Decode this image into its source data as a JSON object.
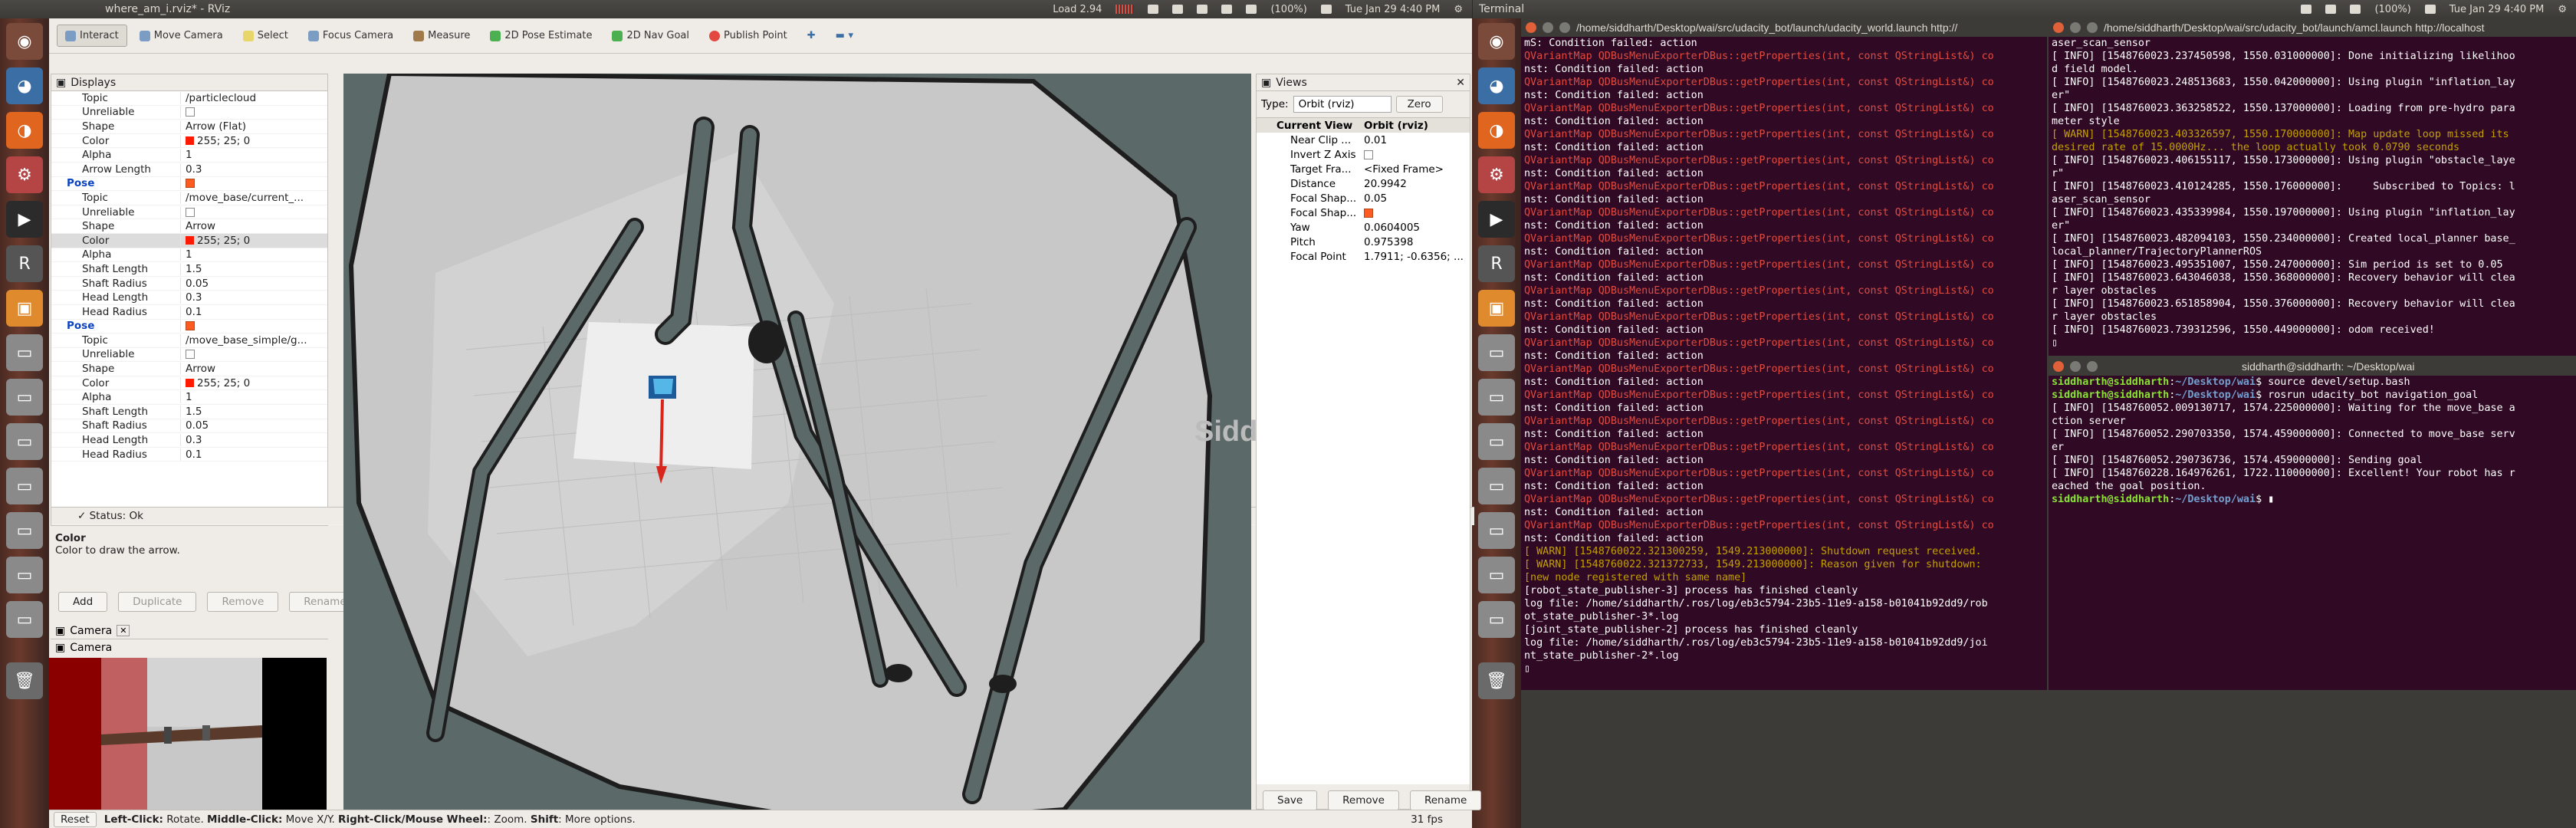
{
  "menubar_left": {
    "title": "where_am_i.rviz* - RViz",
    "load": "Load 2.94",
    "battery": "(100%)",
    "clock": "Tue Jan 29 4:40 PM"
  },
  "menubar_right": {
    "title": "Terminal",
    "battery": "(100%)",
    "clock": "Tue Jan 29 4:40 PM"
  },
  "toolbar": {
    "interact": "Interact",
    "move_camera": "Move Camera",
    "select": "Select",
    "focus_camera": "Focus Camera",
    "measure": "Measure",
    "pose_estimate": "2D Pose Estimate",
    "nav_goal": "2D Nav Goal",
    "publish_point": "Publish Point"
  },
  "displays": {
    "title": "Displays",
    "rows": [
      {
        "k": "Topic",
        "v": "/particlecloud"
      },
      {
        "k": "Unreliable",
        "v": "",
        "chk": "off"
      },
      {
        "k": "Shape",
        "v": "Arrow (Flat)"
      },
      {
        "k": "Color",
        "v": "255; 25; 0",
        "swatch": true
      },
      {
        "k": "Alpha",
        "v": "1"
      },
      {
        "k": "Arrow Length",
        "v": "0.3"
      },
      {
        "k": "Pose",
        "v": "",
        "chk": "on",
        "sec": true
      },
      {
        "k": "✓ Status: Ok",
        "v": "",
        "status": true
      },
      {
        "k": "Topic",
        "v": "/move_base/current_..."
      },
      {
        "k": "Unreliable",
        "v": "",
        "chk": "off"
      },
      {
        "k": "Shape",
        "v": "Arrow"
      },
      {
        "k": "Color",
        "v": "255; 25; 0",
        "swatch": true,
        "sel": true
      },
      {
        "k": "Alpha",
        "v": "1"
      },
      {
        "k": "Shaft Length",
        "v": "1.5"
      },
      {
        "k": "Shaft Radius",
        "v": "0.05"
      },
      {
        "k": "Head Length",
        "v": "0.3"
      },
      {
        "k": "Head Radius",
        "v": "0.1"
      },
      {
        "k": "Pose",
        "v": "",
        "chk": "on",
        "sec": true
      },
      {
        "k": "✓ Status: Ok",
        "v": "",
        "status": true
      },
      {
        "k": "Topic",
        "v": "/move_base_simple/g..."
      },
      {
        "k": "Unreliable",
        "v": "",
        "chk": "off"
      },
      {
        "k": "Shape",
        "v": "Arrow"
      },
      {
        "k": "Color",
        "v": "255; 25; 0",
        "swatch": true
      },
      {
        "k": "Alpha",
        "v": "1"
      },
      {
        "k": "Shaft Length",
        "v": "1.5"
      },
      {
        "k": "Shaft Radius",
        "v": "0.05"
      },
      {
        "k": "Head Length",
        "v": "0.3"
      },
      {
        "k": "Head Radius",
        "v": "0.1"
      }
    ]
  },
  "description": {
    "title": "Color",
    "text": "Color to draw the arrow."
  },
  "buttons": {
    "add": "Add",
    "duplicate": "Duplicate",
    "remove": "Remove",
    "rename": "Rename"
  },
  "camera": {
    "tab1": "Camera",
    "tab2": "Camera"
  },
  "status": {
    "reset": "Reset",
    "hint_b1": "Left-Click:",
    "hint_t1": " Rotate. ",
    "hint_b2": "Middle-Click:",
    "hint_t2": " Move X/Y. ",
    "hint_b3": "Right-Click/Mouse Wheel:",
    "hint_t3": ": Zoom. ",
    "hint_b4": "Shift",
    "hint_t4": ": More options.",
    "fps": "31 fps"
  },
  "views": {
    "title": "Views",
    "type_label": "Type:",
    "type_value": "Orbit (rviz)",
    "zero": "Zero",
    "header_k": "Current View",
    "header_v": "Orbit (rviz)",
    "rows": [
      {
        "k": "Near Clip ...",
        "v": "0.01"
      },
      {
        "k": "Invert Z Axis",
        "v": "",
        "chk": "off"
      },
      {
        "k": "Target Fra...",
        "v": "<Fixed Frame>"
      },
      {
        "k": "Distance",
        "v": "20.9942"
      },
      {
        "k": "Focal Shap...",
        "v": "0.05"
      },
      {
        "k": "Focal Shap...",
        "v": "",
        "chk": "on"
      },
      {
        "k": "Yaw",
        "v": "0.0604005"
      },
      {
        "k": "Pitch",
        "v": "0.975398"
      },
      {
        "k": "Focal Point",
        "v": "1.7911; -0.6356; ..."
      }
    ],
    "save": "Save",
    "remove": "Remove",
    "rename": "Rename"
  },
  "watermark": "Siddharth Kothiyal",
  "term1": {
    "title": "/home/siddharth/Desktop/wai/src/udacity_bot/launch/udacity_world.launch http://",
    "lines": [
      {
        "c": "",
        "t": "mS: Condition failed: action"
      },
      {
        "c": "red",
        "t": "QVariantMap QDBusMenuExporterDBus::getProperties(int, const QStringList&) co"
      },
      {
        "c": "",
        "t": "nst: Condition failed: action"
      },
      {
        "c": "red",
        "t": "QVariantMap QDBusMenuExporterDBus::getProperties(int, const QStringList&) co"
      },
      {
        "c": "",
        "t": "nst: Condition failed: action"
      },
      {
        "c": "red",
        "t": "QVariantMap QDBusMenuExporterDBus::getProperties(int, const QStringList&) co"
      },
      {
        "c": "",
        "t": "nst: Condition failed: action"
      },
      {
        "c": "red",
        "t": "QVariantMap QDBusMenuExporterDBus::getProperties(int, const QStringList&) co"
      },
      {
        "c": "",
        "t": "nst: Condition failed: action"
      },
      {
        "c": "red",
        "t": "QVariantMap QDBusMenuExporterDBus::getProperties(int, const QStringList&) co"
      },
      {
        "c": "",
        "t": "nst: Condition failed: action"
      },
      {
        "c": "red",
        "t": "QVariantMap QDBusMenuExporterDBus::getProperties(int, const QStringList&) co"
      },
      {
        "c": "",
        "t": "nst: Condition failed: action"
      },
      {
        "c": "red",
        "t": "QVariantMap QDBusMenuExporterDBus::getProperties(int, const QStringList&) co"
      },
      {
        "c": "",
        "t": "nst: Condition failed: action"
      },
      {
        "c": "red",
        "t": "QVariantMap QDBusMenuExporterDBus::getProperties(int, const QStringList&) co"
      },
      {
        "c": "",
        "t": "nst: Condition failed: action"
      },
      {
        "c": "red",
        "t": "QVariantMap QDBusMenuExporterDBus::getProperties(int, const QStringList&) co"
      },
      {
        "c": "",
        "t": "nst: Condition failed: action"
      },
      {
        "c": "red",
        "t": "QVariantMap QDBusMenuExporterDBus::getProperties(int, const QStringList&) co"
      },
      {
        "c": "",
        "t": "nst: Condition failed: action"
      },
      {
        "c": "red",
        "t": "QVariantMap QDBusMenuExporterDBus::getProperties(int, const QStringList&) co"
      },
      {
        "c": "",
        "t": "nst: Condition failed: action"
      },
      {
        "c": "red",
        "t": "QVariantMap QDBusMenuExporterDBus::getProperties(int, const QStringList&) co"
      },
      {
        "c": "",
        "t": "nst: Condition failed: action"
      },
      {
        "c": "red",
        "t": "QVariantMap QDBusMenuExporterDBus::getProperties(int, const QStringList&) co"
      },
      {
        "c": "",
        "t": "nst: Condition failed: action"
      },
      {
        "c": "red",
        "t": "QVariantMap QDBusMenuExporterDBus::getProperties(int, const QStringList&) co"
      },
      {
        "c": "",
        "t": "nst: Condition failed: action"
      },
      {
        "c": "red",
        "t": "QVariantMap QDBusMenuExporterDBus::getProperties(int, const QStringList&) co"
      },
      {
        "c": "",
        "t": "nst: Condition failed: action"
      },
      {
        "c": "red",
        "t": "QVariantMap QDBusMenuExporterDBus::getProperties(int, const QStringList&) co"
      },
      {
        "c": "",
        "t": "nst: Condition failed: action"
      },
      {
        "c": "red",
        "t": "QVariantMap QDBusMenuExporterDBus::getProperties(int, const QStringList&) co"
      },
      {
        "c": "",
        "t": "nst: Condition failed: action"
      },
      {
        "c": "red",
        "t": "QVariantMap QDBusMenuExporterDBus::getProperties(int, const QStringList&) co"
      },
      {
        "c": "",
        "t": "nst: Condition failed: action"
      },
      {
        "c": "red",
        "t": "QVariantMap QDBusMenuExporterDBus::getProperties(int, const QStringList&) co"
      },
      {
        "c": "",
        "t": "nst: Condition failed: action"
      },
      {
        "c": "yel",
        "t": "[ WARN] [1548760022.321300259, 1549.213000000]: Shutdown request received."
      },
      {
        "c": "yel",
        "t": "[ WARN] [1548760022.321372733, 1549.213000000]: Reason given for shutdown:"
      },
      {
        "c": "yel",
        "t": "[new node registered with same name]"
      },
      {
        "c": "",
        "t": "[robot_state_publisher-3] process has finished cleanly"
      },
      {
        "c": "",
        "t": "log file: /home/siddharth/.ros/log/eb3c5794-23b5-11e9-a158-b01041b92dd9/rob"
      },
      {
        "c": "",
        "t": "ot_state_publisher-3*.log"
      },
      {
        "c": "",
        "t": "[joint_state_publisher-2] process has finished cleanly"
      },
      {
        "c": "",
        "t": "log file: /home/siddharth/.ros/log/eb3c5794-23b5-11e9-a158-b01041b92dd9/joi"
      },
      {
        "c": "",
        "t": "nt_state_publisher-2*.log"
      },
      {
        "c": "",
        "t": "▯"
      }
    ]
  },
  "term2": {
    "title": "/home/siddharth/Desktop/wai/src/udacity_bot/launch/amcl.launch http://localhost",
    "lines": [
      {
        "c": "",
        "t": "aser_scan_sensor"
      },
      {
        "c": "",
        "t": "[ INFO] [1548760023.237450598, 1550.031000000]: Done initializing likelihoo"
      },
      {
        "c": "",
        "t": "d field model."
      },
      {
        "c": "",
        "t": "[ INFO] [1548760023.248513683, 1550.042000000]: Using plugin \"inflation_lay"
      },
      {
        "c": "",
        "t": "er\""
      },
      {
        "c": "",
        "t": "[ INFO] [1548760023.363258522, 1550.137000000]: Loading from pre-hydro para"
      },
      {
        "c": "",
        "t": "meter style"
      },
      {
        "c": "yel",
        "t": "[ WARN] [1548760023.403326597, 1550.170000000]: Map update loop missed its"
      },
      {
        "c": "yel",
        "t": "desired rate of 15.0000Hz... the loop actually took 0.0790 seconds"
      },
      {
        "c": "",
        "t": "[ INFO] [1548760023.406155117, 1550.173000000]: Using plugin \"obstacle_laye"
      },
      {
        "c": "",
        "t": "r\""
      },
      {
        "c": "",
        "t": "[ INFO] [1548760023.410124285, 1550.176000000]:     Subscribed to Topics: l"
      },
      {
        "c": "",
        "t": "aser_scan_sensor"
      },
      {
        "c": "",
        "t": "[ INFO] [1548760023.435339984, 1550.197000000]: Using plugin \"inflation_lay"
      },
      {
        "c": "",
        "t": "er\""
      },
      {
        "c": "",
        "t": "[ INFO] [1548760023.482094103, 1550.234000000]: Created local_planner base_"
      },
      {
        "c": "",
        "t": "local_planner/TrajectoryPlannerROS"
      },
      {
        "c": "",
        "t": "[ INFO] [1548760023.495351007, 1550.247000000]: Sim period is set to 0.05"
      },
      {
        "c": "",
        "t": "[ INFO] [1548760023.643046038, 1550.368000000]: Recovery behavior will clea"
      },
      {
        "c": "",
        "t": "r layer obstacles"
      },
      {
        "c": "",
        "t": "[ INFO] [1548760023.651858904, 1550.376000000]: Recovery behavior will clea"
      },
      {
        "c": "",
        "t": "r layer obstacles"
      },
      {
        "c": "",
        "t": "[ INFO] [1548760023.739312596, 1550.449000000]: odom received!"
      },
      {
        "c": "",
        "t": "▯"
      }
    ]
  },
  "term3": {
    "title": "siddharth@siddharth: ~/Desktop/wai",
    "lines": [
      {
        "p": "siddharth@siddharth",
        "d": "~/Desktop/wai",
        "t": "$ source devel/setup.bash"
      },
      {
        "p": "siddharth@siddharth",
        "d": "~/Desktop/wai",
        "t": "$ rosrun udacity_bot navigation_goal"
      },
      {
        "c": "",
        "t": "[ INFO] [1548760052.009130717, 1574.225000000]: Waiting for the move_base a"
      },
      {
        "c": "",
        "t": "ction server"
      },
      {
        "c": "",
        "t": "[ INFO] [1548760052.290703350, 1574.459000000]: Connected to move_base serv"
      },
      {
        "c": "",
        "t": "er"
      },
      {
        "c": "",
        "t": "[ INFO] [1548760052.290736736, 1574.459000000]: Sending goal"
      },
      {
        "c": "",
        "t": "[ INFO] [1548760228.164976261, 1722.110000000]: Excellent! Your robot has r"
      },
      {
        "c": "",
        "t": "eached the goal position."
      },
      {
        "p": "siddharth@siddharth",
        "d": "~/Desktop/wai",
        "t": "$ ▮"
      }
    ]
  }
}
